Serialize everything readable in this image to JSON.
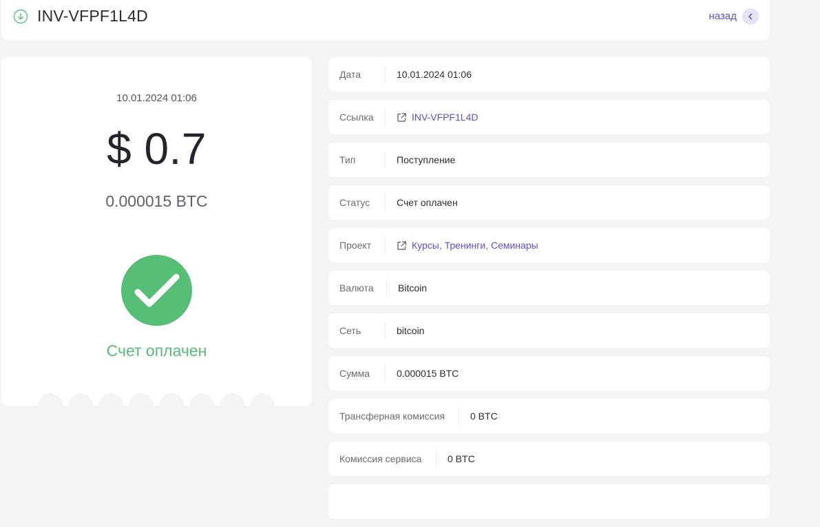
{
  "header": {
    "title": "INV-VFPF1L4D",
    "back_label": "назад",
    "icon": "download-circle-icon",
    "accent": "#57be78"
  },
  "summary": {
    "date": "10.01.2024 01:06",
    "amount": "$ 0.7",
    "crypto_amount": "0.000015 BTC",
    "status": "Счет оплачен",
    "status_color": "#57be78",
    "status_icon": "check-icon"
  },
  "details": [
    {
      "label": "Дата",
      "value": "10.01.2024 01:06",
      "link": false
    },
    {
      "label": "Ссылка",
      "value": "INV-VFPF1L4D",
      "link": true,
      "icon": "external-link-icon"
    },
    {
      "label": "Тип",
      "value": "Поступление",
      "link": false
    },
    {
      "label": "Статус",
      "value": "Счет оплачен",
      "link": false
    },
    {
      "label": "Проект",
      "value": "Курсы, Тренинги, Семинары",
      "link": true,
      "icon": "external-link-icon"
    },
    {
      "label": "Валюта",
      "value": "Bitcoin",
      "link": false
    },
    {
      "label": "Сеть",
      "value": "bitcoin",
      "link": false
    },
    {
      "label": "Сумма",
      "value": "0.000015 BTC",
      "link": false
    },
    {
      "label": "Трансферная комиссия",
      "value": "0 BTC",
      "link": false
    },
    {
      "label": "Комиссия сервиса",
      "value": "0 BTC",
      "link": false
    }
  ],
  "colors": {
    "link": "#5b4fc9",
    "background": "#f4f4f4",
    "card": "#ffffff"
  }
}
